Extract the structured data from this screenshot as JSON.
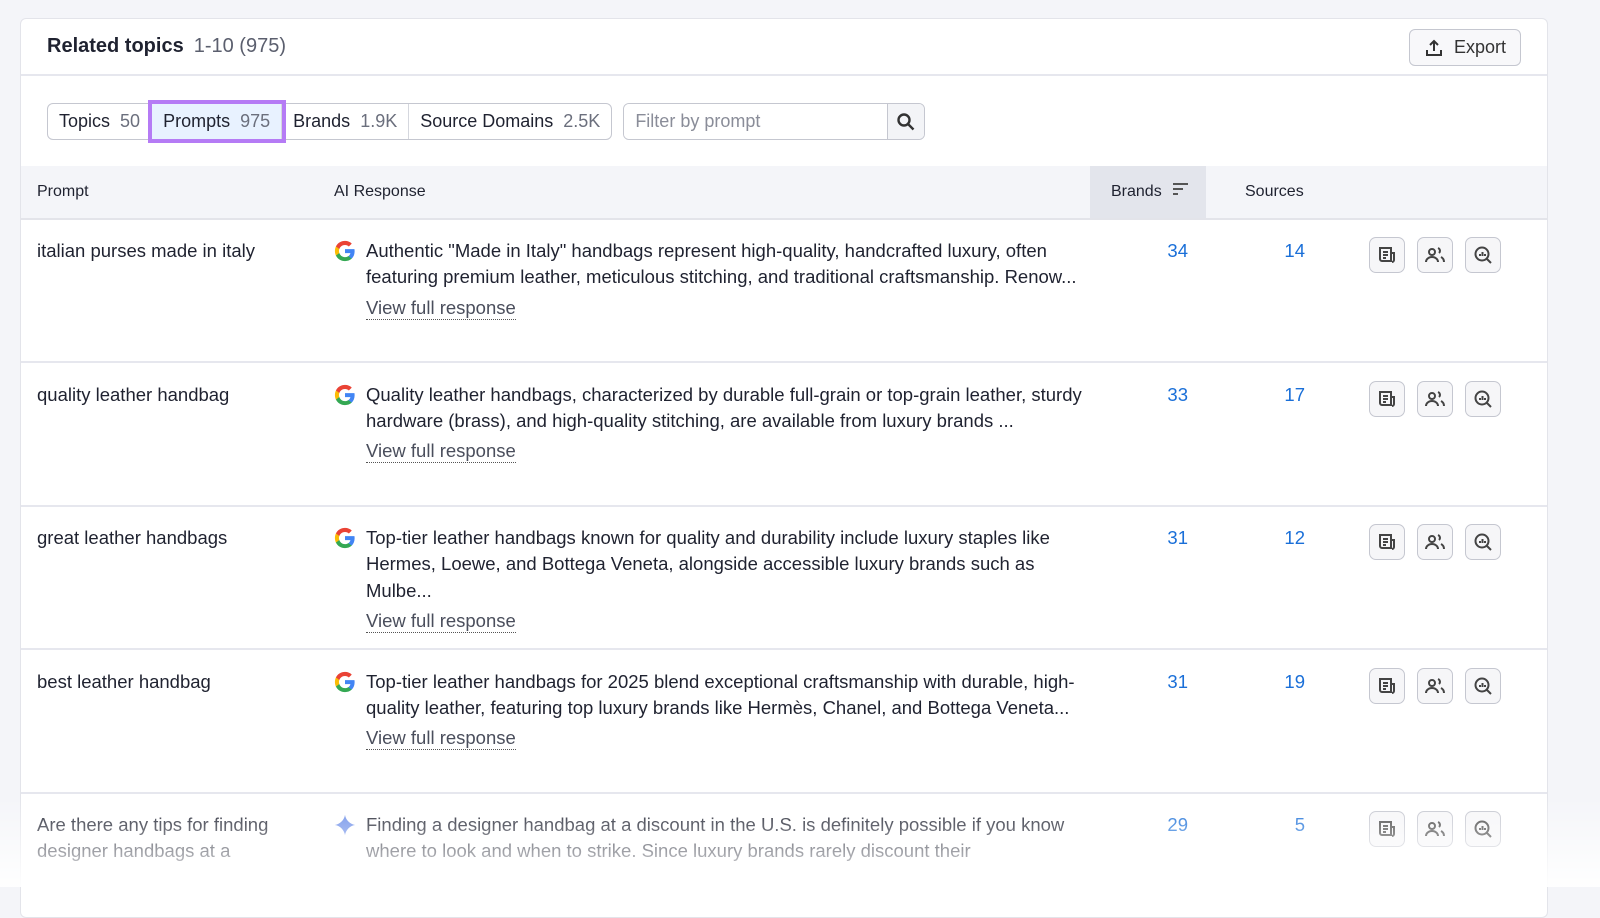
{
  "header": {
    "title": "Related topics",
    "range": "1-10 (975)",
    "export_label": "Export"
  },
  "tabs": [
    {
      "label": "Topics",
      "count": "50"
    },
    {
      "label": "Prompts",
      "count": "975"
    },
    {
      "label": "Brands",
      "count": "1.9K"
    },
    {
      "label": "Source Domains",
      "count": "2.5K"
    }
  ],
  "search": {
    "placeholder": "Filter by prompt",
    "value": ""
  },
  "columns": {
    "prompt": "Prompt",
    "response": "AI Response",
    "brands": "Brands",
    "sources": "Sources"
  },
  "view_label": "View full response",
  "rows": [
    {
      "prompt": "italian purses made in italy",
      "source": "google",
      "response": "Authentic \"Made in Italy\" handbags represent high-quality, handcrafted luxury, often featuring premium leather, meticulous stitching, and traditional craftsmanship. Renow...",
      "brands": "34",
      "sources": "14"
    },
    {
      "prompt": "quality leather handbag",
      "source": "google",
      "response": "Quality leather handbags, characterized by durable full-grain or top-grain leather, sturdy hardware (brass), and high-quality stitching, are available from luxury brands ...",
      "brands": "33",
      "sources": "17"
    },
    {
      "prompt": "great leather handbags",
      "source": "google",
      "response": "Top-tier leather handbags known for quality and durability include luxury staples like Hermes, Loewe, and Bottega Veneta, alongside accessible luxury brands such as Mulbe...",
      "brands": "31",
      "sources": "12"
    },
    {
      "prompt": "best leather handbag",
      "source": "google",
      "response": "Top-tier leather handbags for 2025 blend exceptional craftsmanship with durable, high-quality leather, featuring top luxury brands like Hermès, Chanel, and Bottega Veneta...",
      "brands": "31",
      "sources": "19"
    },
    {
      "prompt": "Are there any tips for finding designer handbags at a",
      "source": "gemini",
      "response": "Finding a designer handbag at a discount in the U.S. is definitely possible if you know where to look and when to strike. Since luxury brands rarely discount their",
      "brands": "29",
      "sources": "5"
    }
  ],
  "colors": {
    "accent": "#1a6fd8",
    "highlight": "#b57bf5"
  }
}
